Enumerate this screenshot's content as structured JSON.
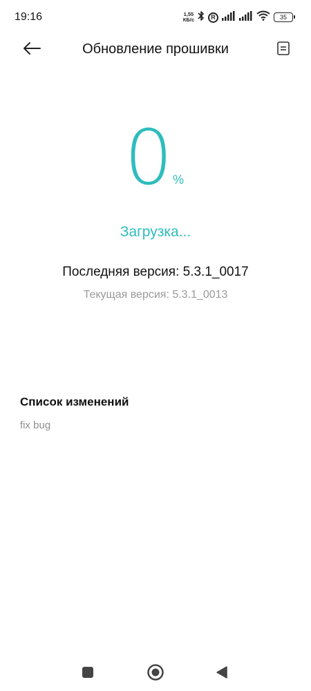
{
  "status_bar": {
    "time": "19:16",
    "speed_value": "1,55",
    "speed_unit": "КБ/с",
    "r_badge": "R",
    "battery": "35",
    "icons": [
      "bluetooth-icon",
      "roaming-icon",
      "signal-icon",
      "signal-icon",
      "wifi-icon",
      "battery-icon"
    ]
  },
  "app_bar": {
    "title": "Обновление прошивки",
    "back_icon": "arrow-left-icon",
    "log_icon": "document-icon"
  },
  "progress": {
    "value": "0",
    "unit": "%",
    "state": "Загрузка..."
  },
  "versions": {
    "latest": "Последняя версия: 5.3.1_0017",
    "current": "Текущая версия: 5.3.1_0013"
  },
  "changelog": {
    "title": "Список изменений",
    "items": [
      "fix bug"
    ]
  },
  "colors": {
    "accent": "#2ebdbe",
    "text_primary": "#111111",
    "text_secondary": "#9a9a9a"
  },
  "nav_bar": {
    "icons": [
      "square-icon",
      "circle-icon",
      "triangle-back-icon"
    ]
  }
}
